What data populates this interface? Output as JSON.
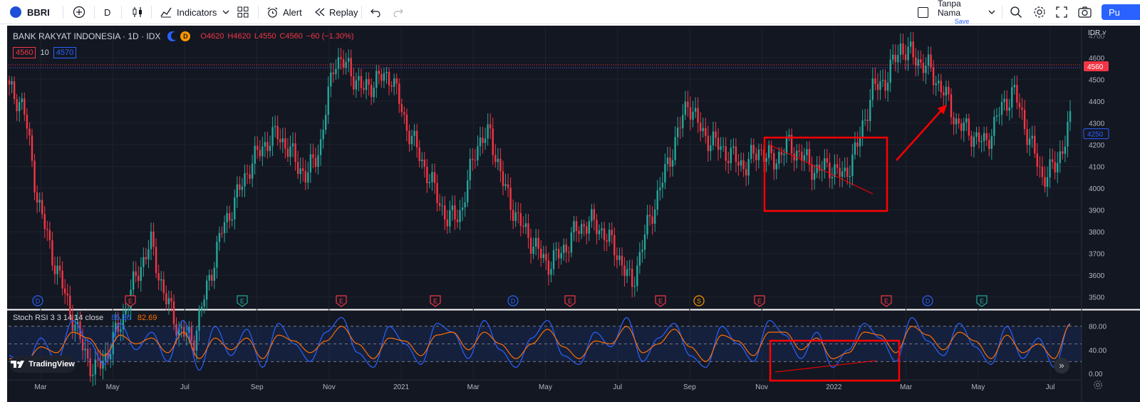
{
  "toolbar": {
    "symbol": "BBRI",
    "interval": "D",
    "indicators_label": "Indicators",
    "alert_label": "Alert",
    "replay_label": "Replay",
    "layout_name": "Tanpa Nama",
    "save_label": "Save",
    "publish_label": "Pu"
  },
  "legend": {
    "title": "BANK RAKYAT INDONESIA · 1D · IDX",
    "o": "O4620",
    "h": "H4620",
    "l": "L4550",
    "c": "C4560",
    "chg": "−60 (−1.30%)",
    "bid": "4560",
    "qty": "10",
    "ask": "4570"
  },
  "price_axis": {
    "currency": "IDR",
    "top_partial": "4700",
    "last_price": "4560",
    "crosshair_price": "4250"
  },
  "oscillator": {
    "name": "Stoch RSI 3 3 14 14 close",
    "k": "85.36",
    "d": "82.69"
  },
  "watermark": "TradingView",
  "colors": {
    "up": "#26a69a",
    "down": "#f23645",
    "k_line": "#2962ff",
    "d_line": "#ff6d00",
    "annotation": "#ff0000",
    "background": "#131722"
  },
  "chart_data": [
    {
      "type": "candlestick",
      "title": "BANK RAKYAT INDONESIA · 1D · IDX",
      "ylim": [
        3450,
        4740
      ],
      "y_ticks": [
        3500,
        3600,
        3700,
        3800,
        3900,
        4000,
        4100,
        4200,
        4300,
        4400,
        4500,
        4600
      ],
      "x_ticks": [
        "Mar",
        "May",
        "Jul",
        "Sep",
        "Nov",
        "2021",
        "Mar",
        "May",
        "Jul",
        "Sep",
        "Nov",
        "2022",
        "Mar",
        "May",
        "Jul"
      ],
      "approx_closes": [
        4450,
        4380,
        3950,
        3700,
        3500,
        3300,
        3150,
        3250,
        3400,
        3600,
        3750,
        3500,
        3350,
        3300,
        3550,
        3800,
        3950,
        4100,
        4200,
        4250,
        4150,
        4050,
        4200,
        4600,
        4550,
        4450,
        4500,
        4520,
        4300,
        4150,
        4000,
        3850,
        3900,
        4200,
        4250,
        4000,
        3850,
        3750,
        3650,
        3700,
        3800,
        3850,
        3800,
        3700,
        3550,
        3800,
        4000,
        4200,
        4400,
        4250,
        4200,
        4150,
        4100,
        4180,
        4120,
        4200,
        4150,
        4080,
        4100,
        4050,
        4200,
        4450,
        4500,
        4650,
        4600,
        4550,
        4450,
        4300,
        4250,
        4200,
        4350,
        4450,
        4250,
        4050,
        4100,
        4300
      ],
      "event_markers": [
        "D",
        "E",
        "E",
        "E",
        "E",
        "D",
        "E",
        "E",
        "S",
        "E",
        "E",
        "D",
        "E"
      ],
      "grid": true,
      "last_value": 4560
    },
    {
      "type": "line",
      "title": "Stoch RSI 3 3 14 14 close",
      "ylim": [
        -5,
        105
      ],
      "y_ticks": [
        0,
        40,
        80
      ],
      "y_tick_labels": [
        "0.00",
        "40.00",
        "80.00"
      ],
      "bands": [
        20,
        50,
        80
      ],
      "series": [
        {
          "name": "K",
          "last": 85.36,
          "values": [
            30,
            10,
            60,
            20,
            90,
            55,
            15,
            85,
            40,
            70,
            20,
            90,
            5,
            80,
            30,
            75,
            10,
            85,
            50,
            20,
            70,
            95,
            35,
            10,
            80,
            50,
            15,
            85,
            70,
            25,
            90,
            40,
            10,
            60,
            90,
            30,
            15,
            70,
            45,
            95,
            20,
            60,
            85,
            30,
            10,
            80,
            50,
            20,
            90,
            65,
            25,
            70,
            10,
            40,
            85,
            60,
            20,
            95,
            55,
            30,
            85,
            45,
            15,
            80,
            25,
            60,
            10,
            85
          ]
        },
        {
          "name": "D",
          "last": 82.69,
          "values": [
            25,
            20,
            45,
            35,
            70,
            60,
            30,
            65,
            50,
            60,
            35,
            70,
            25,
            60,
            40,
            60,
            25,
            65,
            55,
            35,
            55,
            80,
            50,
            25,
            60,
            55,
            30,
            65,
            70,
            40,
            70,
            50,
            25,
            50,
            75,
            45,
            25,
            55,
            50,
            80,
            35,
            50,
            75,
            45,
            20,
            65,
            55,
            30,
            70,
            70,
            40,
            60,
            25,
            35,
            70,
            65,
            35,
            80,
            65,
            40,
            70,
            55,
            25,
            65,
            35,
            50,
            25,
            83
          ]
        }
      ]
    }
  ]
}
